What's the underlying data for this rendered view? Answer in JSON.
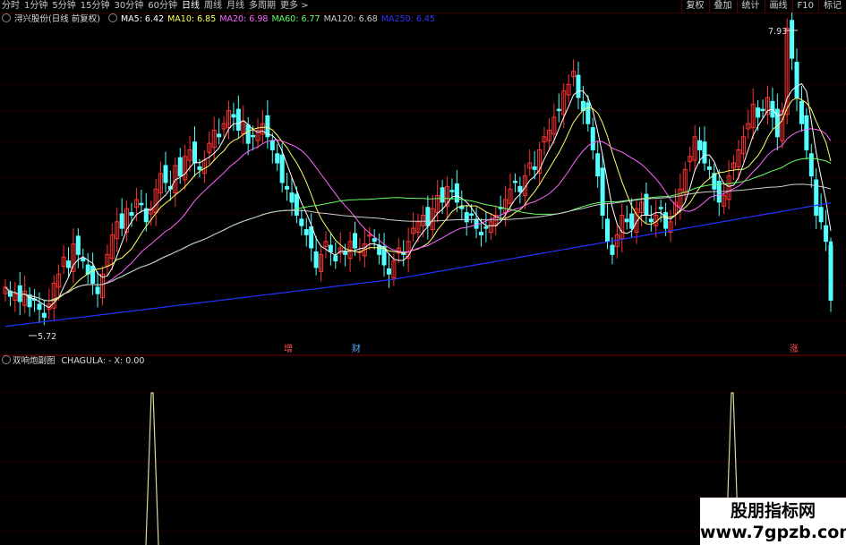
{
  "toolbar": {
    "periods": [
      "分时",
      "1分钟",
      "5分钟",
      "15分钟",
      "30分钟",
      "60分钟",
      "日线",
      "周线",
      "月线",
      "多周期",
      "更多 >"
    ],
    "active_period": "日线",
    "right_buttons": [
      "复权",
      "叠加",
      "统计",
      "画线",
      "F10",
      "标记"
    ]
  },
  "legend": {
    "stock": "浔兴股份(日线 前复权)",
    "ma": [
      {
        "label": "MA5: 6.42",
        "color": "#ffffff"
      },
      {
        "label": "MA10: 6.85",
        "color": "#ffff66"
      },
      {
        "label": "MA20: 6.98",
        "color": "#ff66ff"
      },
      {
        "label": "MA60: 6.77",
        "color": "#66ff66"
      },
      {
        "label": "MA120: 6.68",
        "color": "#cccccc"
      },
      {
        "label": "MA250: 6.45",
        "color": "#3333ff"
      }
    ]
  },
  "annotations": {
    "high": "7.93",
    "low": "5.72"
  },
  "event_markers": [
    "增",
    "财",
    "涨"
  ],
  "indicator": {
    "name": "双响炮副图",
    "formula": "CHAGULA: - X: 0.00"
  },
  "watermark": {
    "line1": "股朋指标网",
    "line2": "www.7gpzb.com"
  },
  "colors": {
    "up": "#ff3232",
    "down": "#54ffff",
    "ma250": "#2233ff",
    "grid": "#3a0000"
  },
  "chart_data": {
    "type": "candlestick",
    "y_visible_range": [
      5.6,
      8.05
    ],
    "series_close": [
      5.95,
      5.88,
      5.9,
      5.84,
      5.92,
      5.8,
      5.85,
      5.78,
      5.72,
      5.82,
      5.98,
      6.05,
      6.18,
      6.1,
      6.28,
      6.2,
      6.15,
      6.05,
      5.98,
      5.9,
      6.05,
      6.2,
      6.35,
      6.45,
      6.4,
      6.55,
      6.5,
      6.62,
      6.58,
      6.45,
      6.55,
      6.7,
      6.82,
      6.75,
      6.7,
      6.88,
      6.8,
      6.95,
      7.0,
      6.9,
      6.85,
      6.92,
      7.05,
      7.15,
      7.1,
      7.2,
      7.3,
      7.25,
      7.15,
      7.22,
      7.05,
      7.1,
      7.15,
      7.2,
      7.1,
      7.0,
      6.9,
      6.75,
      6.7,
      6.6,
      6.5,
      6.42,
      6.35,
      6.25,
      6.1,
      6.2,
      6.3,
      6.22,
      6.15,
      6.25,
      6.2,
      6.3,
      6.25,
      6.22,
      6.28,
      6.35,
      6.3,
      6.2,
      6.12,
      6.05,
      6.15,
      6.25,
      6.2,
      6.3,
      6.4,
      6.45,
      6.5,
      6.42,
      6.55,
      6.65,
      6.6,
      6.72,
      6.68,
      6.6,
      6.55,
      6.45,
      6.5,
      6.4,
      6.35,
      6.4,
      6.45,
      6.5,
      6.55,
      6.62,
      6.7,
      6.75,
      6.68,
      6.8,
      6.9,
      6.85,
      7.0,
      7.1,
      7.15,
      7.25,
      7.3,
      7.45,
      7.5,
      7.6,
      7.4,
      7.3,
      7.2,
      7.0,
      6.8,
      6.5,
      6.3,
      6.2,
      6.35,
      6.5,
      6.45,
      6.4,
      6.55,
      6.6,
      6.5,
      6.45,
      6.5,
      6.55,
      6.4,
      6.45,
      6.6,
      6.7,
      6.85,
      6.95,
      7.1,
      7.0,
      6.9,
      6.85,
      6.7,
      6.6,
      6.65,
      6.8,
      6.9,
      7.0,
      7.1,
      7.2,
      7.35,
      7.25,
      7.3,
      7.4,
      7.25,
      7.1,
      7.3,
      7.93,
      7.7,
      7.4,
      7.2,
      7.0,
      6.8,
      6.5,
      6.45,
      6.3,
      5.85
    ],
    "indicator_spikes_x": [
      170,
      818
    ]
  }
}
